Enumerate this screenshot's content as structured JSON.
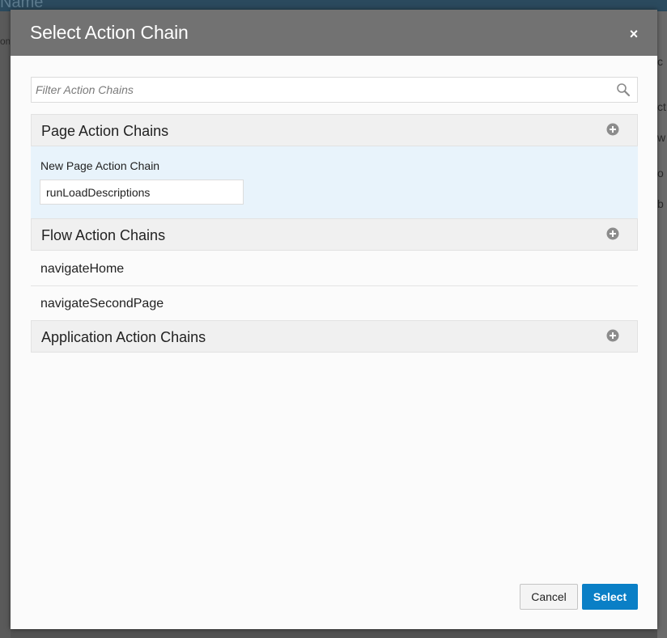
{
  "background": {
    "topbar_text": "Name",
    "left_fragment": "om",
    "right_fragments": [
      "c",
      "ct",
      "w",
      "o",
      "b"
    ]
  },
  "dialog": {
    "title": "Select Action Chain",
    "close_symbol": "×",
    "filter": {
      "placeholder": "Filter Action Chains",
      "value": ""
    },
    "sections": {
      "page": {
        "title": "Page Action Chains",
        "new_chain_label": "New Page Action Chain",
        "new_chain_value": "runLoadDescriptions"
      },
      "flow": {
        "title": "Flow Action Chains",
        "items": [
          "navigateHome",
          "navigateSecondPage"
        ]
      },
      "application": {
        "title": "Application Action Chains"
      }
    },
    "buttons": {
      "cancel": "Cancel",
      "select": "Select"
    }
  },
  "colors": {
    "header_bg": "#727272",
    "section_bg": "#f0f0f0",
    "highlight_bg": "#e8f3fb",
    "primary": "#0a7fc6"
  },
  "icons": {
    "search": "search-icon",
    "add": "add-circle-icon",
    "close": "close-icon"
  }
}
